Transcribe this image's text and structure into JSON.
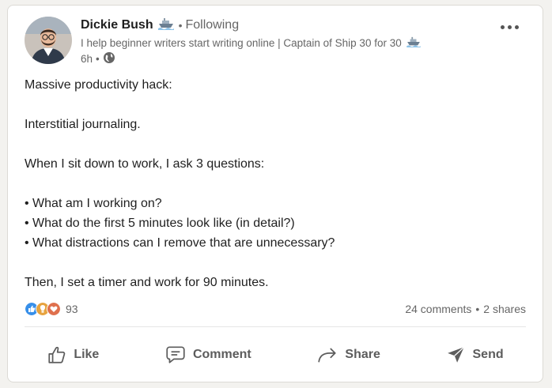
{
  "post": {
    "author": {
      "name": "Dickie Bush",
      "follow_status": "Following",
      "headline": "I help beginner writers start writing online | Captain of Ship 30 for 30",
      "time": "6h",
      "separator": "•"
    },
    "body_lines": [
      "Massive productivity hack:",
      "",
      "Interstitial journaling.",
      "",
      "When I sit down to work, I ask 3 questions:",
      "",
      "• What am I working on?",
      "• What do the first 5 minutes look like (in detail?)",
      "• What distractions can I remove that are unnecessary?",
      "",
      "Then, I set a timer and work for 90 minutes."
    ],
    "social": {
      "reaction_count": "93",
      "comments": "24 comments",
      "shares": "2 shares",
      "separator": "•"
    },
    "actions": {
      "like": "Like",
      "comment": "Comment",
      "share": "Share",
      "send": "Send"
    }
  },
  "colors": {
    "like_blue": "#378fe9",
    "celebrate_gold": "#e7a33e",
    "love_red": "#df704d",
    "text_primary": "#1f1f1f",
    "text_secondary": "#666666"
  },
  "icons": [
    "ship-icon",
    "globe-icon",
    "more-icon",
    "like-reaction-icon",
    "insightful-reaction-icon",
    "love-reaction-icon",
    "like-icon",
    "comment-icon",
    "share-icon",
    "send-icon"
  ]
}
